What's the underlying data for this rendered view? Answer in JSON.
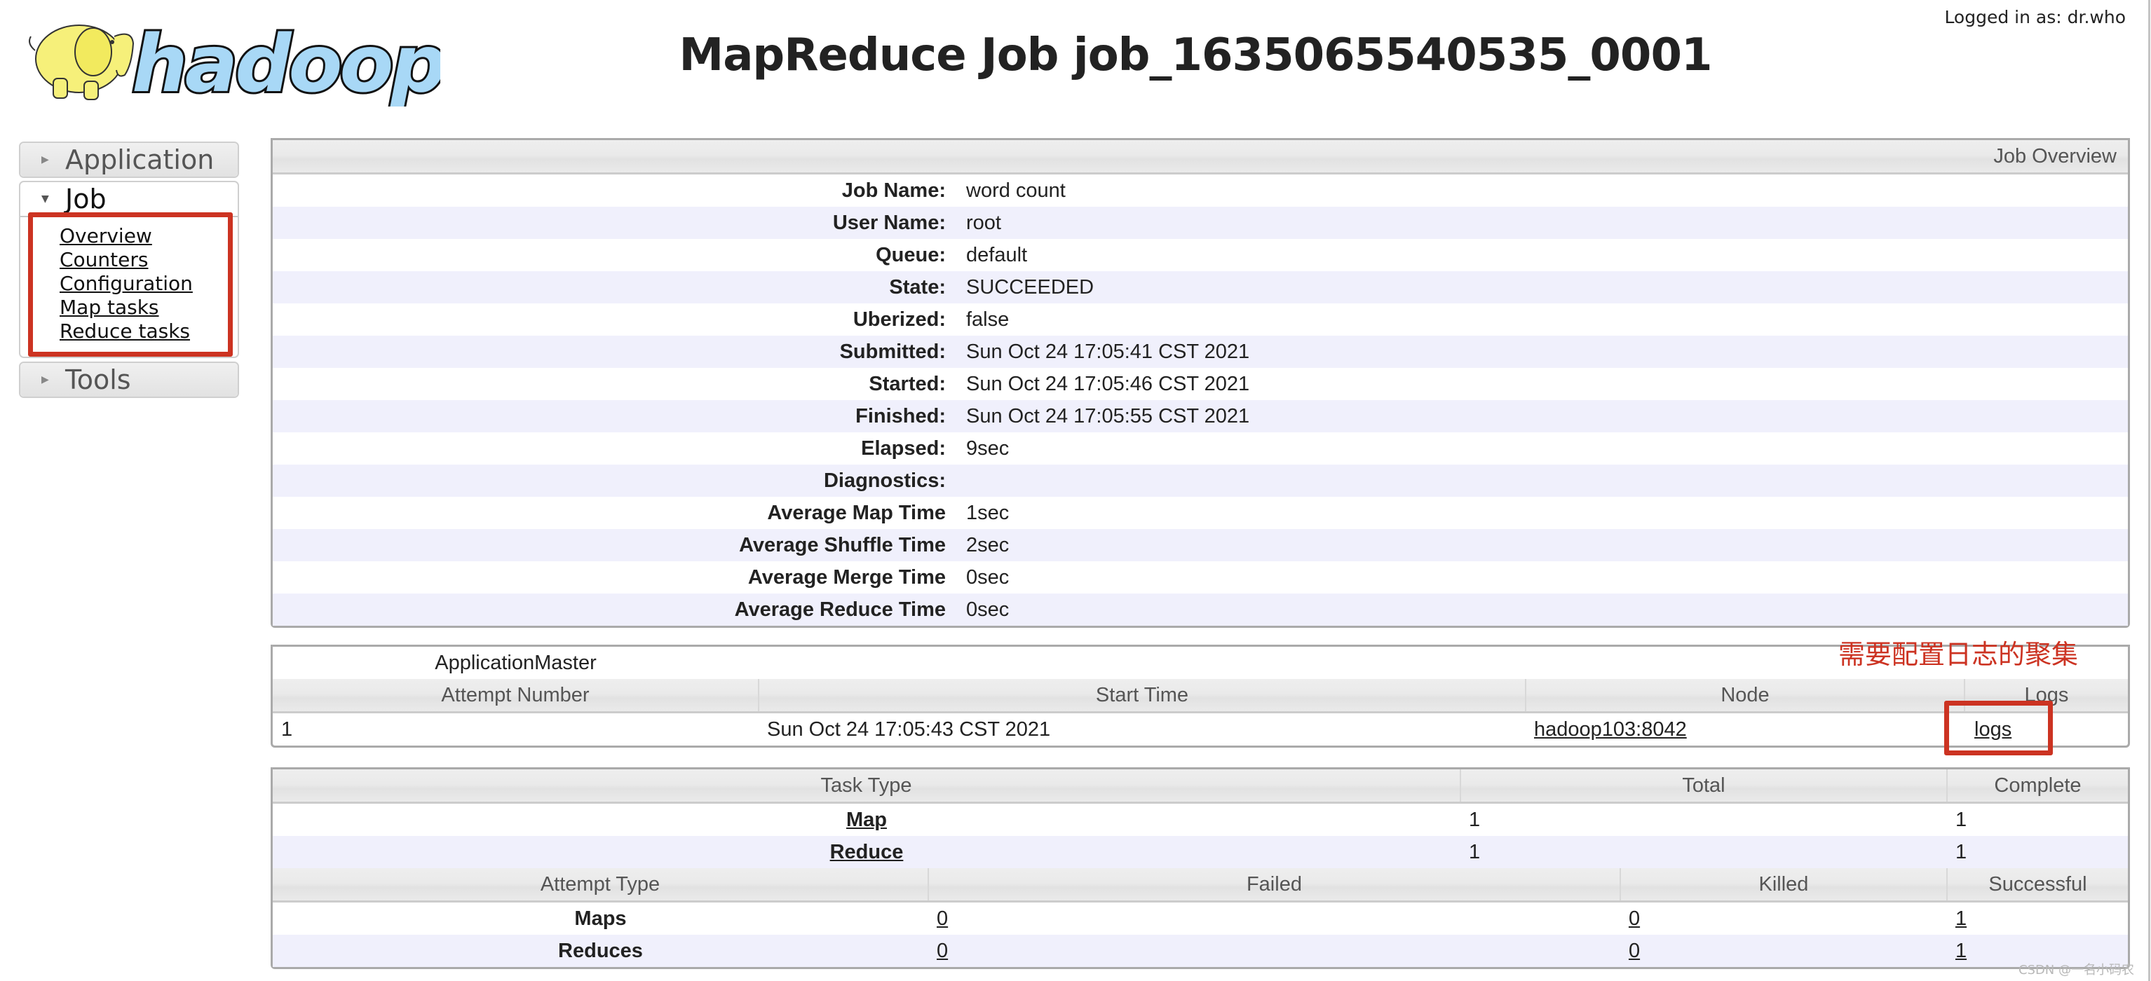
{
  "header": {
    "logo_alt": "hadoop",
    "title": "MapReduce Job job_1635065540535_0001",
    "logged_in": "Logged in as: dr.who"
  },
  "sidebar": {
    "application": {
      "label": "Application",
      "icon": "triangle-right-icon"
    },
    "job": {
      "label": "Job",
      "icon": "triangle-down-icon",
      "links": [
        "Overview",
        "Counters",
        "Configuration",
        "Map tasks",
        "Reduce tasks"
      ]
    },
    "tools": {
      "label": "Tools",
      "icon": "triangle-right-icon"
    }
  },
  "overview": {
    "heading": "Job Overview",
    "rows": [
      {
        "label": "Job Name:",
        "value": "word count"
      },
      {
        "label": "User Name:",
        "value": "root"
      },
      {
        "label": "Queue:",
        "value": "default"
      },
      {
        "label": "State:",
        "value": "SUCCEEDED"
      },
      {
        "label": "Uberized:",
        "value": "false"
      },
      {
        "label": "Submitted:",
        "value": "Sun Oct 24 17:05:41 CST 2021"
      },
      {
        "label": "Started:",
        "value": "Sun Oct 24 17:05:46 CST 2021"
      },
      {
        "label": "Finished:",
        "value": "Sun Oct 24 17:05:55 CST 2021"
      },
      {
        "label": "Elapsed:",
        "value": "9sec"
      },
      {
        "label": "Diagnostics:",
        "value": ""
      },
      {
        "label": "Average Map Time",
        "value": "1sec"
      },
      {
        "label": "Average Shuffle Time",
        "value": "2sec"
      },
      {
        "label": "Average Merge Time",
        "value": "0sec"
      },
      {
        "label": "Average Reduce Time",
        "value": "0sec"
      }
    ]
  },
  "app_master": {
    "caption": "ApplicationMaster",
    "columns": [
      "Attempt Number",
      "Start Time",
      "Node",
      "Logs"
    ],
    "rows": [
      {
        "attempt": "1",
        "start_time": "Sun Oct 24 17:05:43 CST 2021",
        "node": "hadoop103:8042",
        "logs": "logs"
      }
    ]
  },
  "tasks": {
    "columns": [
      "Task Type",
      "Total",
      "Complete"
    ],
    "rows": [
      {
        "type": "Map",
        "total": "1",
        "complete": "1"
      },
      {
        "type": "Reduce",
        "total": "1",
        "complete": "1"
      }
    ],
    "attempt_columns": [
      "Attempt Type",
      "Failed",
      "Killed",
      "Successful"
    ],
    "attempt_rows": [
      {
        "type": "Maps",
        "failed": "0",
        "killed": "0",
        "successful": "1"
      },
      {
        "type": "Reduces",
        "failed": "0",
        "killed": "0",
        "successful": "1"
      }
    ]
  },
  "annotation": {
    "text": "需要配置日志的聚集",
    "color": "#cc3322"
  },
  "watermark": "CSDN @一名小码农"
}
